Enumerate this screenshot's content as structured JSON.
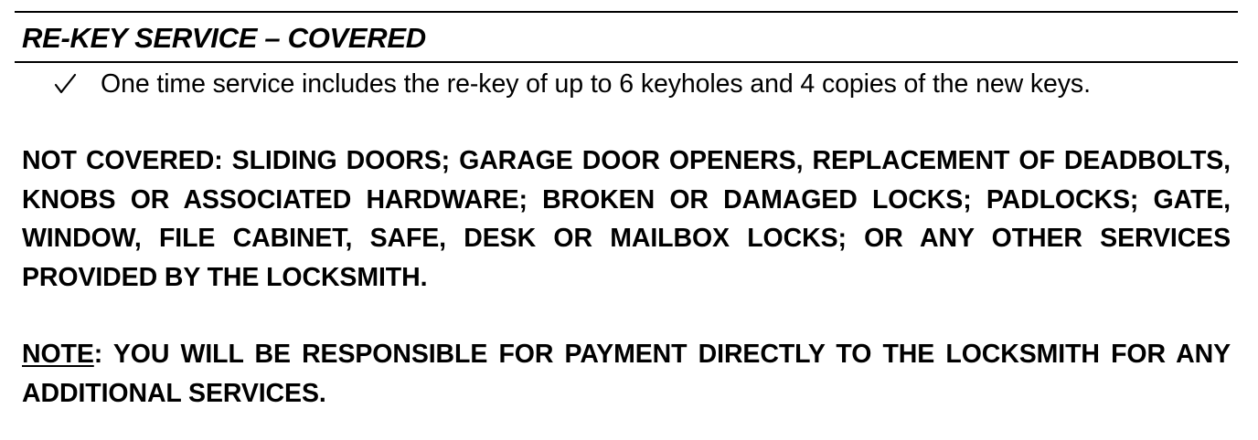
{
  "heading": "RE-KEY SERVICE – COVERED",
  "covered": {
    "items": [
      {
        "icon": "checkmark-icon",
        "text": "One time service includes the re-key of up to 6 keyholes and 4 copies of the new keys."
      }
    ]
  },
  "not_covered": {
    "text": "NOT COVERED: SLIDING DOORS; GARAGE DOOR OPENERS, REPLACEMENT OF DEADBOLTS, KNOBS OR ASSOCIATED HARDWARE; BROKEN OR DAMAGED LOCKS; PADLOCKS; GATE, WINDOW, FILE CABINET, SAFE, DESK OR MAILBOX LOCKS; OR ANY OTHER SERVICES PROVIDED BY THE LOCKSMITH."
  },
  "note": {
    "label": "NOTE",
    "text": ": YOU WILL BE RESPONSIBLE FOR PAYMENT DIRECTLY TO THE LOCKSMITH FOR ANY ADDITIONAL SERVICES."
  }
}
